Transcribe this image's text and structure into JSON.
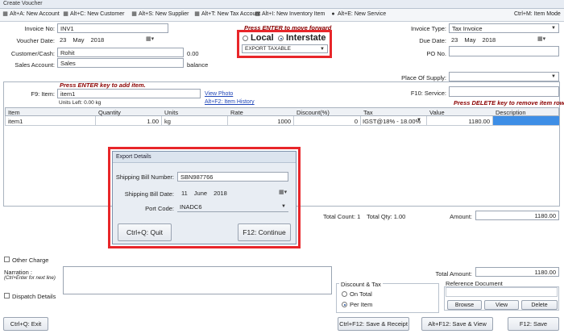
{
  "window": {
    "title": "Create Voucher"
  },
  "toolbar": {
    "items": [
      {
        "label": "Alt+A: New Account",
        "icon": "new-account-icon"
      },
      {
        "label": "Alt+C: New Customer",
        "icon": "new-customer-icon"
      },
      {
        "label": "Alt+S: New Supplier",
        "icon": "new-supplier-icon"
      },
      {
        "label": "Alt+T: New Tax Account",
        "icon": "new-tax-account-icon"
      },
      {
        "label": "Alt+I: New Inventory Item",
        "icon": "new-inventory-item-icon"
      },
      {
        "label": "Alt+E: New Service",
        "icon": "new-service-icon"
      }
    ],
    "item_mode": "Ctrl+M: Item Mode"
  },
  "header": {
    "invoice_no_label": "Invoice No:",
    "invoice_no": "INV1",
    "voucher_date_label": "Voucher Date:",
    "voucher_date": {
      "day": "23",
      "month": "May",
      "year": "2018"
    },
    "customer_label": "Customer/Cash:",
    "customer": "Rohit",
    "customer_amount": "0.00",
    "sales_account_label": "Sales Account:",
    "sales_account": "Sales",
    "balance_label": "balance",
    "hint": "Press ENTER to move forward",
    "local_label": "Local",
    "interstate_label": "Interstate",
    "export_type": "EXPORT TAXABLE",
    "invoice_type_label": "Invoice Type:",
    "invoice_type": "Tax Invoice",
    "due_date_label": "Due Date:",
    "due_date": {
      "day": "23",
      "month": "May",
      "year": "2018"
    },
    "po_no_label": "PO No.",
    "po_no": "",
    "place_of_supply_label": "Place Of Supply:",
    "place_of_supply": ""
  },
  "item_entry": {
    "hint": "Press ENTER key to add item.",
    "item_label": "F9: Item:",
    "item": "item1",
    "units_left": "Units Left: 0.00 kg",
    "view_photo": "View Photo",
    "item_history": "Alt+F2: Item History",
    "service_label": "F10: Service:",
    "service": "",
    "delete_hint": "Press DELETE key to remove item row."
  },
  "grid": {
    "columns": [
      "Item",
      "Quantity",
      "Units",
      "Rate",
      "Discount(%)",
      "Tax",
      "Value",
      "Description"
    ],
    "rows": [
      {
        "item": "item1",
        "quantity": "1.00",
        "units": "kg",
        "rate": "1000",
        "discount": "0",
        "tax": "IGST@18% - 18.00%",
        "value": "1180.00",
        "description": ""
      }
    ]
  },
  "dialog": {
    "title": "Export Details",
    "shipping_bill_number_label": "Shipping Bill Number:",
    "shipping_bill_number": "SBN987766",
    "shipping_bill_date_label": "Shipping Bill Date:",
    "shipping_bill_date": {
      "day": "11",
      "month": "June",
      "year": "2018"
    },
    "port_code_label": "Port Code:",
    "port_code": "INADC6",
    "quit_button": "Ctrl+Q: Quit",
    "continue_button": "F12: Continue"
  },
  "totals": {
    "total_count": "Total Count: 1",
    "total_qty": "Total Qty: 1.00",
    "amount_label": "Amount:",
    "amount": "1180.00",
    "total_amount_label": "Total Amount:",
    "total_amount": "1180.00"
  },
  "footer": {
    "other_charge": "Other Charge",
    "narration_label": "Narration :",
    "narration_hint": "(Ctrl+Enter for next line)",
    "dispatch_details": "Dispatch Details",
    "discount_tax_label": "Discount & Tax",
    "on_total": "On Total",
    "per_item": "Per Item",
    "reference_document": "Reference Document",
    "browse": "Browse",
    "view": "View",
    "delete": "Delete",
    "exit": "Ctrl+Q: Exit",
    "save_receipt": "Ctrl+F12: Save & Receipt",
    "save_view": "Alt+F12: Save & View",
    "save": "F12: Save"
  }
}
